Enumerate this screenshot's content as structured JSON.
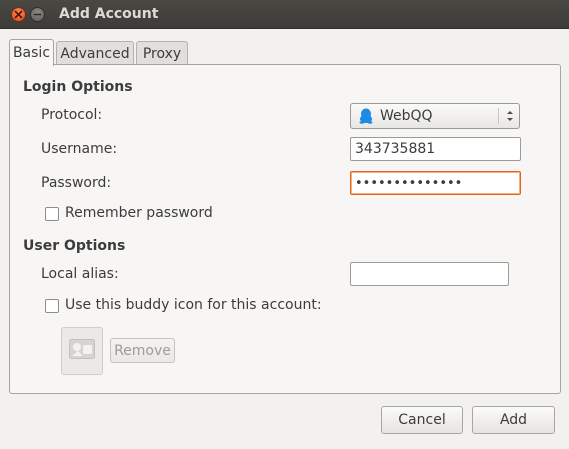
{
  "window": {
    "title": "Add Account"
  },
  "tabs": [
    {
      "label": "Basic",
      "active": true
    },
    {
      "label": "Advanced",
      "active": false
    },
    {
      "label": "Proxy",
      "active": false
    }
  ],
  "login_options": {
    "title": "Login Options",
    "protocol_label": "Protocol:",
    "protocol_value": "WebQQ",
    "protocol_icon": "penguin-icon",
    "username_label": "Username:",
    "username_value": "343735881",
    "password_label": "Password:",
    "password_value": "••••••••••••••",
    "remember_password_label": "Remember password",
    "remember_password_checked": false
  },
  "user_options": {
    "title": "User Options",
    "local_alias_label": "Local alias:",
    "local_alias_value": "",
    "buddy_icon_label": "Use this buddy icon for this account:",
    "buddy_icon_checked": false,
    "remove_label": "Remove"
  },
  "footer": {
    "cancel_label": "Cancel",
    "add_label": "Add"
  },
  "colors": {
    "titlebar": "#3d3c38",
    "focus_border": "#e0661a",
    "close_button": "#df4a16",
    "protocol_icon": "#1d8be3"
  }
}
